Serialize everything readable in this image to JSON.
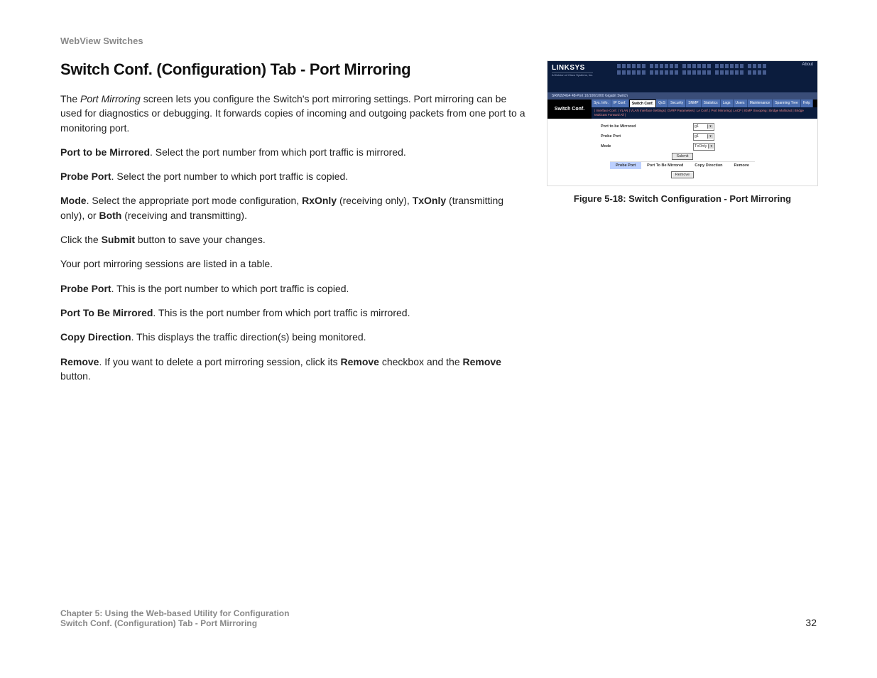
{
  "header": "WebView Switches",
  "title": "Switch Conf. (Configuration) Tab - Port Mirroring",
  "intro_1": "The ",
  "intro_em": "Port Mirroring",
  "intro_2": " screen lets you configure the Switch's port mirroring settings. Port mirroring can be used for diagnostics or debugging. It forwards copies of incoming and outgoing packets from one port to a monitoring port.",
  "p_port_to_be_b": "Port to be Mirrored",
  "p_port_to_be": ". Select the port number from which port traffic is mirrored.",
  "p_probe_b": "Probe Port",
  "p_probe": ". Select the port number to which port traffic is copied.",
  "p_mode_b": "Mode",
  "p_mode_1": ". Select the appropriate port mode configuration, ",
  "p_mode_rx": "RxOnly",
  "p_mode_2": " (receiving only), ",
  "p_mode_tx": "TxOnly",
  "p_mode_3": " (transmitting only), or ",
  "p_mode_both": "Both",
  "p_mode_4": " (receiving and transmitting).",
  "p_submit_1": "Click the ",
  "p_submit_b": "Submit",
  "p_submit_2": " button to save your changes.",
  "p_sessions": "Your port mirroring sessions are listed in a table.",
  "p_probe2_b": "Probe Port",
  "p_probe2": ". This is the port number to which port traffic is copied.",
  "p_ptbm_b": "Port To Be Mirrored",
  "p_ptbm": ". This is the port number from which port traffic is mirrored.",
  "p_copy_b": "Copy Direction",
  "p_copy": ". This displays the traffic direction(s) being monitored.",
  "p_remove_b": "Remove",
  "p_remove_1": ". If you want to delete a port mirroring session, click its ",
  "p_remove_ck": "Remove",
  "p_remove_2": " checkbox and the ",
  "p_remove_btn": "Remove",
  "p_remove_3": " button.",
  "figure_caption": "Figure 5-18: Switch Configuration - Port Mirroring",
  "footer_line1": "Chapter 5: Using the Web-based Utility for Configuration",
  "footer_line2": "Switch Conf. (Configuration) Tab - Port Mirroring",
  "page_number": "32",
  "mini": {
    "logo": "LINKSYS",
    "logo_sub": "A Division of Cisco Systems, Inc.",
    "about": "About",
    "device_desc": "SRW224G4 48-Port 10/100/1000 Gigabit Switch",
    "side_label": "Switch Conf.",
    "tabs": [
      "Sys. Info.",
      "IP Conf.",
      "Switch Conf.",
      "QoS",
      "Security",
      "SNMP",
      "Statistics",
      "Lags",
      "Users",
      "Maintenance",
      "Spanning Tree",
      "Help"
    ],
    "subtabs": "| Interface Conf. | VLAN | VLAN Interface Settings | GVRP Parameters | LA Conf. | Port Mirroring | LACP | IGMP Snooping | Bridge Multicast | Bridge Multicast Forward All |",
    "form": {
      "row1_label": "Port to be Mirrored",
      "row1_value": "g1",
      "row2_label": "Probe Port",
      "row2_value": "g1",
      "row3_label": "Mode",
      "row3_value": "TxOnly"
    },
    "submit_btn": "Submit",
    "table_headers": [
      "Probe Port",
      "Port To Be Mirrored",
      "Copy Direction",
      "Remove"
    ],
    "remove_btn": "Remove"
  }
}
